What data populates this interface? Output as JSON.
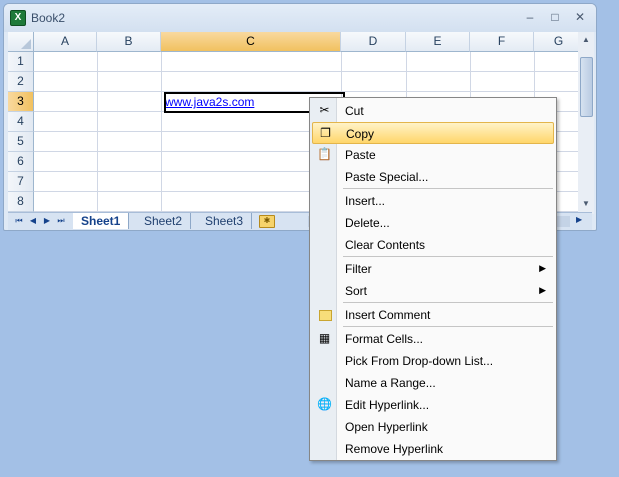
{
  "window": {
    "title": "Book2",
    "app_icon": "excel-icon",
    "controls": [
      "–",
      "□",
      "✕"
    ]
  },
  "grid": {
    "columns": [
      "A",
      "B",
      "C",
      "D",
      "E",
      "F",
      "G"
    ],
    "rows": [
      "1",
      "2",
      "3",
      "4",
      "5",
      "6",
      "7",
      "8"
    ],
    "selected_column": "C",
    "selected_row": "3",
    "cell_c3": "www.java2s.com",
    "link_color": "#0000ff"
  },
  "sheets": {
    "tabs": [
      "Sheet1",
      "Sheet2",
      "Sheet3"
    ],
    "active": "Sheet1",
    "nav_glyphs": [
      "⏮",
      "◀",
      "▶",
      "⏭"
    ]
  },
  "context_menu": {
    "items": [
      {
        "label": "Cut",
        "icon": "scissors-icon"
      },
      {
        "label": "Copy",
        "icon": "copy-icon",
        "highlighted": true
      },
      {
        "label": "Paste",
        "icon": "paste-icon"
      },
      {
        "label": "Paste Special..."
      },
      {
        "label": "Insert..."
      },
      {
        "label": "Delete..."
      },
      {
        "label": "Clear Contents"
      },
      {
        "label": "Filter",
        "submenu": true
      },
      {
        "label": "Sort",
        "submenu": true
      },
      {
        "label": "Insert Comment",
        "icon": "comment-icon"
      },
      {
        "label": "Format Cells...",
        "icon": "format-cells-icon"
      },
      {
        "label": "Pick From Drop-down List..."
      },
      {
        "label": "Name a Range..."
      },
      {
        "label": "Edit Hyperlink...",
        "icon": "hyperlink-icon"
      },
      {
        "label": "Open Hyperlink"
      },
      {
        "label": "Remove Hyperlink"
      }
    ],
    "highlight_color": "#ffd66b"
  },
  "colors": {
    "desktop": "#a3c0e6",
    "header_selected": "#f1c15f"
  }
}
